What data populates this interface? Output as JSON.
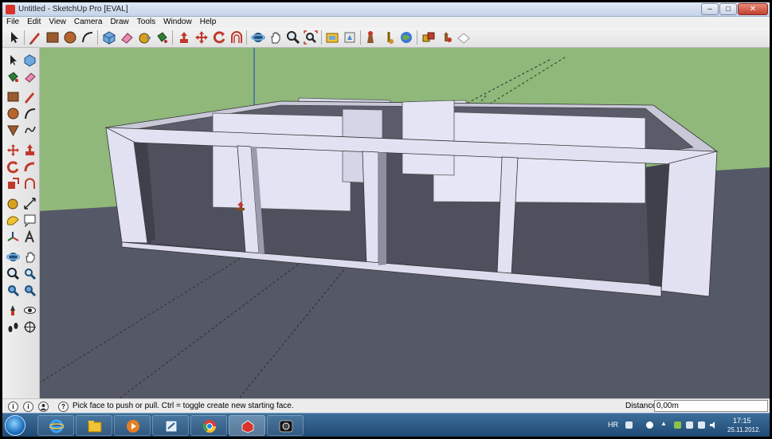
{
  "window": {
    "title": "Untitled - SketchUp Pro [EVAL]",
    "minimize_symbol": "–",
    "maximize_symbol": "□",
    "close_symbol": "✕"
  },
  "menu": {
    "items": [
      "File",
      "Edit",
      "View",
      "Camera",
      "Draw",
      "Tools",
      "Window",
      "Help"
    ]
  },
  "toolbar": {
    "tool_icons": [
      "select-icon",
      "pencil-icon",
      "rectangle-icon",
      "circle-icon",
      "arc-icon",
      "make-component-icon",
      "eraser-icon",
      "tape-measure-icon",
      "paint-bucket-icon",
      "push-pull-icon",
      "move-icon",
      "rotate-icon",
      "offset-icon",
      "orbit-icon",
      "pan-icon",
      "zoom-icon",
      "zoom-extents-icon",
      "previous-view-icon",
      "next-view-icon",
      "get-models-icon",
      "share-model-icon",
      "share-component-icon",
      "google-earth-icon",
      "extensions-icon",
      "sandbox-icon",
      "geo-location-icon"
    ]
  },
  "statusbar": {
    "hint": "Pick face to push or pull.  Ctrl = toggle create new starting face.",
    "distance_label": "Distance",
    "distance_value": "0,00m",
    "help_icons": [
      "geo-icon",
      "credits-icon",
      "user-icon"
    ],
    "help_letters": [
      "i",
      "i",
      "?"
    ]
  },
  "taskbar": {
    "apps": [
      "internet-explorer-icon",
      "explorer-folder-icon",
      "media-player-icon",
      "notepad-icon",
      "chrome-icon",
      "sketchup-icon",
      "camera-app-icon"
    ],
    "language": "HR",
    "time": "17:15",
    "date": "25.11.2012."
  },
  "colors": {
    "sky": "#8fb87a",
    "ground": "#555866",
    "wall_face": "#e6e6f6",
    "wall_top": "#c9c8d8",
    "wall_inner": "#b8b9cc",
    "shadow": "#3f404b"
  }
}
